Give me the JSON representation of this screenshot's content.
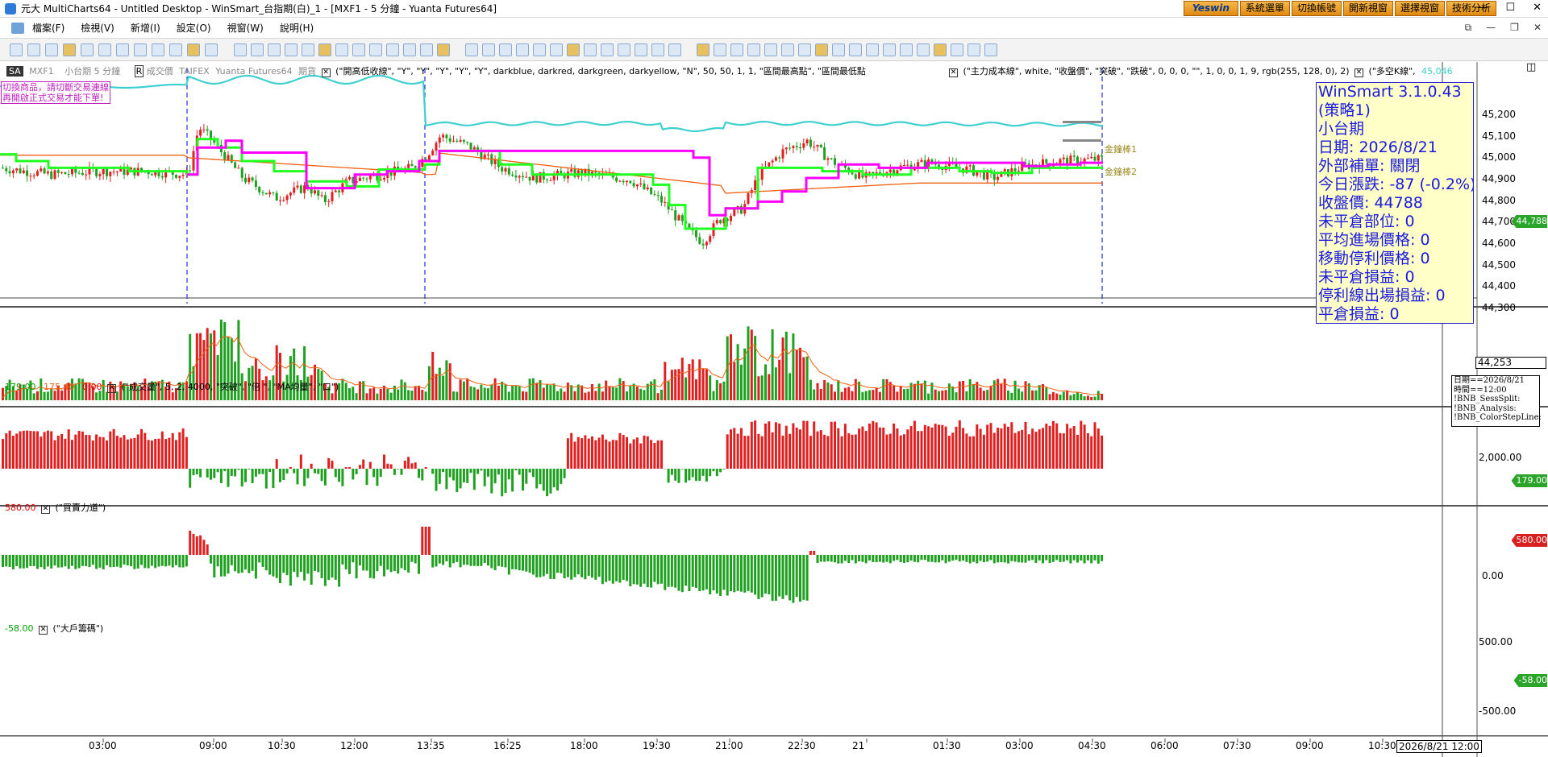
{
  "window": {
    "title": "元大 MultiCharts64 - Untitled Desktop - WinSmart_台指期(白)_1 - [MXF1 - 5 分鐘 - Yuanta Futures64]"
  },
  "topbar": {
    "logo": "Yeswin",
    "buttons": [
      "系統選單",
      "切換帳號",
      "開新視窗",
      "選擇視窗",
      "技術分析"
    ]
  },
  "menu": {
    "items": [
      "檔案(F)",
      "檢視(V)",
      "新增(I)",
      "設定(O)",
      "視窗(W)",
      "說明(H)"
    ]
  },
  "main_legend": {
    "symbol_tag": "SA",
    "symbol": "MXF1",
    "interval": "小台期 5 分鐘",
    "r": "R",
    "price": "成交價",
    "exchange": "TAIFEX",
    "datafeed": "Yuanta Futures64",
    "type": "期貨",
    "ind1": "(\"開高低收線\", \"Y\", \"Y\", \"Y\", \"Y\", \"Y\", darkblue, darkred, darkgreen, darkyellow, \"N\", 50, 50, 1, 1, \"區間最高點\", \"區間最低點",
    "ind2": "(\"主力成本線\", white, \"收盤價\", \"突破\", \"跌破\", 0, 0, 0, \"\", 1, 0, 0, 1, 9, rgb(255, 128, 0), 2)",
    "ind3": "(\"多空K線\",",
    "ind3_val": "45,046"
  },
  "notice": [
    "切換商品，請切斷交易連線",
    "再開啟正式交易才能下單!"
  ],
  "infobox": [
    "WinSmart 3.1.0.43",
    "(策略1)",
    "小台期",
    "日期: 2026/8/21",
    "外部補單: 關閉",
    "今日漲跌: -87 (-0.2%)",
    "收盤價: 44788",
    "未平倉部位: 0",
    "平均進場價格: 0",
    "移動停利價格: 0",
    "未平倉損益: 0",
    "停利線出場損益: 0",
    "平倉損益: 0"
  ],
  "gold": {
    "l1": "金鐘棒1",
    "l2": "金鐘棒2"
  },
  "price_axis": {
    "ticks": [
      "45,200",
      "45,100",
      "45,000",
      "44,900",
      "44,800",
      "44,700",
      "44,600",
      "44,500",
      "44,400",
      "44,300"
    ],
    "last": "44,788",
    "cursor": "44,253"
  },
  "volume_pane": {
    "v1": "179.00",
    "v2": "175.40",
    "v3": "0.00",
    "label": "(\"成交量\", 5, 2, 4000, \"突破\", \"倍 \", \"MA均量\", \"口\")",
    "tick": "2,000.00",
    "last": "179.00"
  },
  "smallinfo": [
    "日期==2026/8/21",
    "時間==12:00",
    "!BNB_SessSplit:",
    "!BNB_Analysis:",
    "!BNB_ColorStepLine:"
  ],
  "buy_pane": {
    "v1": "580.00",
    "label": "(\"買賣力道\")",
    "tick0": "0.00",
    "last": "580.00"
  },
  "big_pane": {
    "v1": "-58.00",
    "label": "(\"大戶籌碼\")",
    "ticks": [
      "500.00",
      "-500.00"
    ],
    "last": "-58.00"
  },
  "time_axis": {
    "labels": [
      "03:00",
      "09:00",
      "10:30",
      "12:00",
      "13:35",
      "16:25",
      "18:00",
      "19:30",
      "21:00",
      "22:30",
      "21",
      "01:30",
      "03:00",
      "04:30",
      "06:00",
      "07:30",
      "09:00",
      "10:30"
    ],
    "cursor": "2026/8/21 12:00"
  },
  "colors": {
    "up": "#e02020",
    "down": "#20a020",
    "cyan": "#40d0d0",
    "orange": "#f06010",
    "green": "#20ff20",
    "magenta": "#ff00ff",
    "info": "#1a1ae0"
  },
  "chart_data": {
    "type": "candlestick",
    "symbol": "MXF1",
    "interval": "5 分鐘",
    "ylim": [
      44253,
      45250
    ],
    "last": 44788,
    "cursor_value": 44253
  }
}
